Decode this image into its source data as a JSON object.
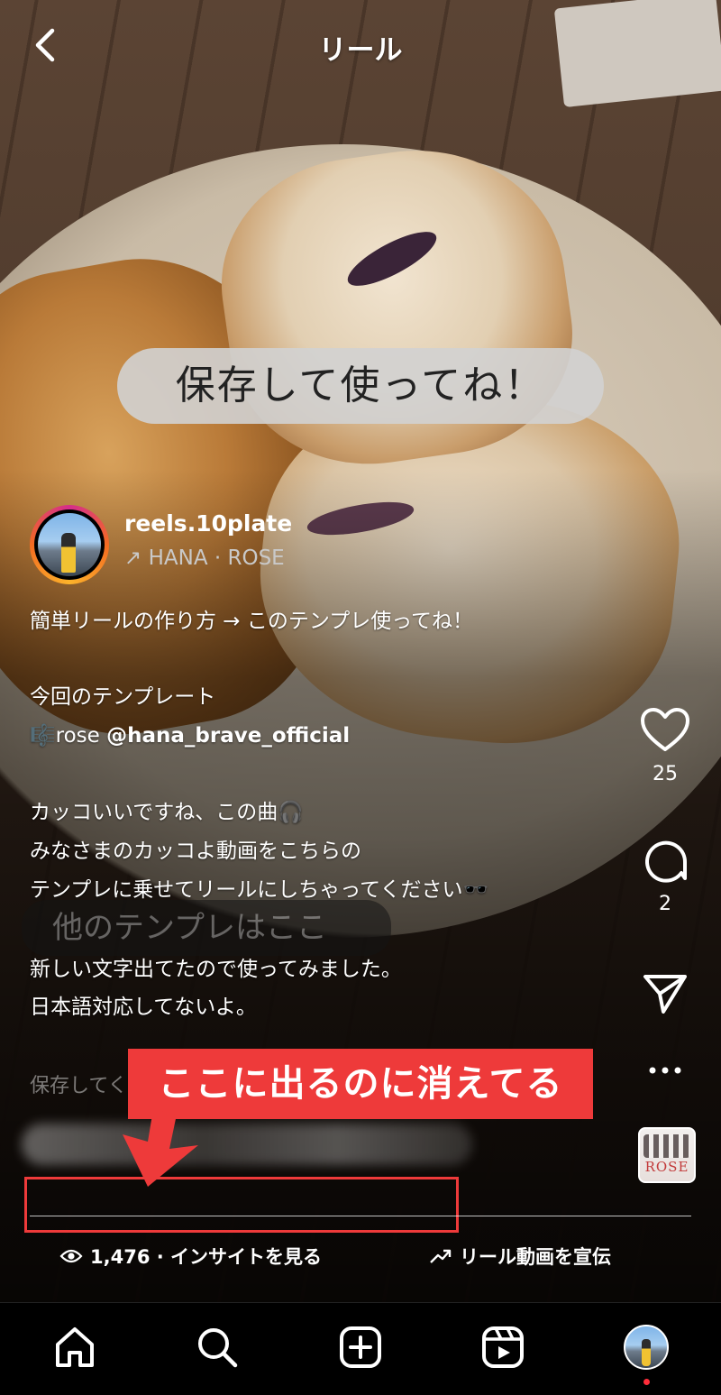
{
  "header": {
    "title": "リール"
  },
  "overlay_text": "保存して使ってね！",
  "author": {
    "username": "reels.10plate",
    "audio_arrow": "↗",
    "audio": "HANA · ROSE"
  },
  "caption": {
    "line1": "簡単リールの作り方 → このテンプレ使ってね！",
    "line2": "今回のテンプレート",
    "line3_prefix": "🎼rose ",
    "line3_mention": "@hana_brave_official",
    "line4": "カッコいいですね、この曲🎧",
    "line5": "みなさまのカッコよ動画をこちらの",
    "line6": "テンプレに乗せてリールにしちゃってください🕶️",
    "line7": "新しい文字出てたので使ってみました。",
    "line8": "日本語対応してないよ。"
  },
  "sticker_text": "他のテンプレはここ",
  "faded_text": "保存してく",
  "annotation": {
    "text": "ここに出るのに消えてる",
    "color": "#ee3a3a"
  },
  "actions": {
    "likes": "25",
    "comments": "2"
  },
  "album": {
    "label": "ROSE"
  },
  "stats": {
    "views": "1,476 · インサイトを見る",
    "promote": "リール動画を宣伝"
  },
  "nav": {
    "items": [
      "home-icon",
      "search-icon",
      "create-icon",
      "reels-icon",
      "profile-avatar"
    ]
  }
}
